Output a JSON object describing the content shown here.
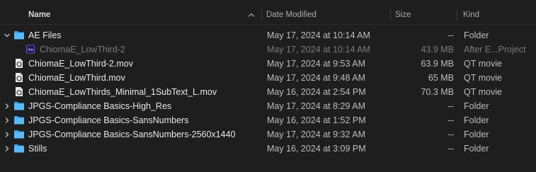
{
  "header": {
    "name": "Name",
    "date_modified": "Date Modified",
    "size": "Size",
    "kind": "Kind"
  },
  "rows": [
    {
      "name": "AE Files",
      "date": "May 17, 2024 at 10:14 AM",
      "size": "--",
      "kind": "Folder",
      "icon": "folder-icon",
      "expanded": true
    },
    {
      "name": "ChiomaE_LowThird-2",
      "date": "May 17, 2024 at 10:14 AM",
      "size": "43.9 MB",
      "kind": "After E...Project",
      "icon": "after-effects-file-icon",
      "dim": true
    },
    {
      "name": "ChiomaE_LowThird-2.mov",
      "date": "May 17, 2024 at 9:53 AM",
      "size": "63.9 MB",
      "kind": "QT movie",
      "icon": "quicktime-file-icon"
    },
    {
      "name": "ChiomaE_LowThird.mov",
      "date": "May 17, 2024 at 9:48 AM",
      "size": "65 MB",
      "kind": "QT movie",
      "icon": "quicktime-file-icon"
    },
    {
      "name": "ChiomaE_LowThirds_Minimal_1SubText_L.mov",
      "date": "May 16, 2024 at 2:54 PM",
      "size": "70.3 MB",
      "kind": "QT movie",
      "icon": "quicktime-file-icon"
    },
    {
      "name": "JPGS-Compliance Basics-High_Res",
      "date": "May 17, 2024 at 8:29 AM",
      "size": "--",
      "kind": "Folder",
      "icon": "folder-icon",
      "expanded": false
    },
    {
      "name": "JPGS-Compliance Basics-SansNumbers",
      "date": "May 16, 2024 at 1:52 PM",
      "size": "--",
      "kind": "Folder",
      "icon": "folder-icon",
      "expanded": false
    },
    {
      "name": "JPGS-Compliance Basics-SansNumbers-2560x1440",
      "date": "May 17, 2024 at 9:32 AM",
      "size": "--",
      "kind": "Folder",
      "icon": "folder-icon",
      "expanded": false
    },
    {
      "name": "Stills",
      "date": "May 16, 2024 at 3:09 PM",
      "size": "--",
      "kind": "Folder",
      "icon": "folder-icon",
      "expanded": false
    }
  ]
}
